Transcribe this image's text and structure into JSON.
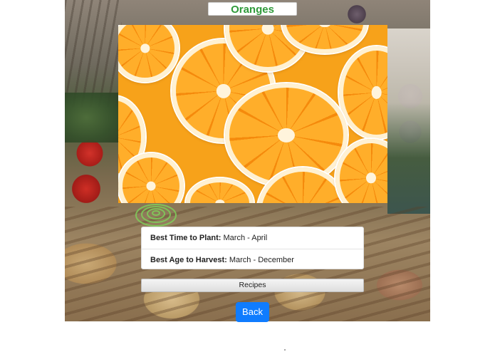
{
  "page": {
    "title": "Oranges",
    "title_color": "#2f9a3a"
  },
  "hero": {
    "subject": "orange-slices-photo"
  },
  "info": {
    "plant_label": "Best Time to Plant:",
    "plant_value": "March - April",
    "harvest_label": "Best Age to Harvest:",
    "harvest_value": "March - December"
  },
  "actions": {
    "recipes_label": "Recipes",
    "back_label": "Back",
    "back_color": "#0f7cff"
  }
}
